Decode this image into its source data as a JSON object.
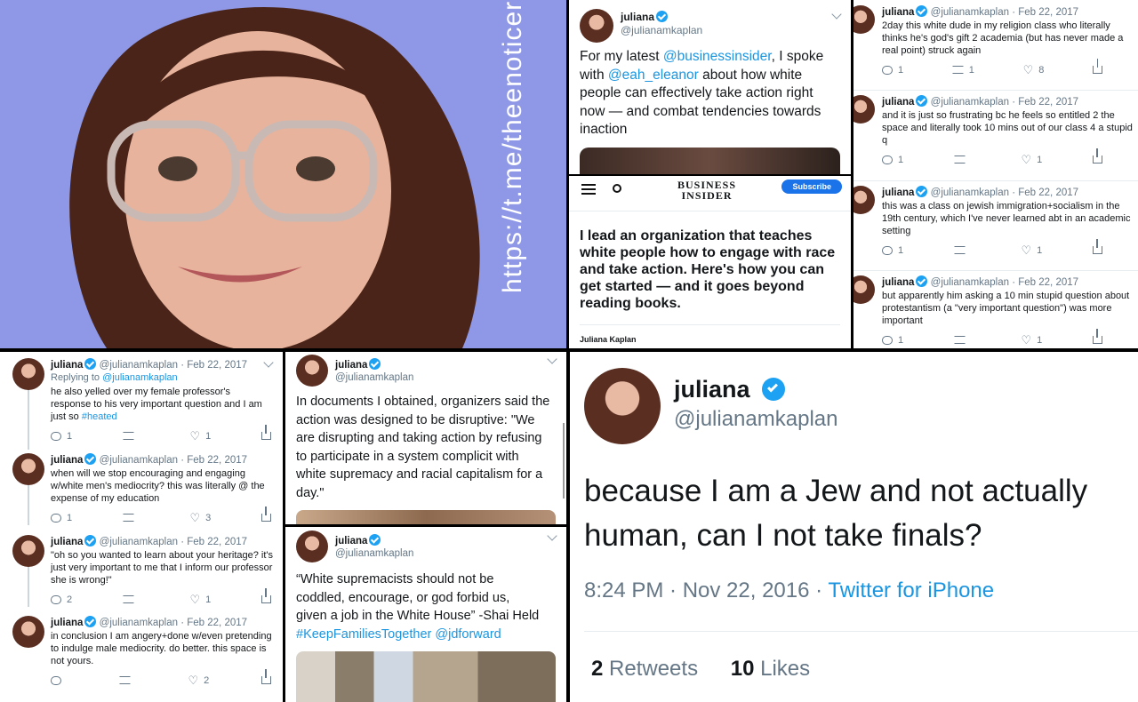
{
  "photo": {
    "watermark": "https://t.me/theenoticer",
    "background": "#8f98e6"
  },
  "user": {
    "name": "juliana",
    "handle": "@julianamkaplan"
  },
  "tweet_bi": {
    "segments": [
      "For my latest ",
      "@businessinsider",
      ", I spoke with ",
      "@eah_eleanor",
      " about how white people can effectively take action right now — and combat tendencies towards inaction"
    ]
  },
  "article": {
    "logo_line1": "BUSINESS",
    "logo_line2": "INSIDER",
    "subscribe": "Subscribe",
    "headline": "I lead an organization that teaches white people how to engage with race and take action. Here's how you can get started — and it goes beyond reading books.",
    "author": "Juliana Kaplan"
  },
  "thread_right": [
    {
      "date": "· Feb 22, 2017",
      "text": "2day this white dude in my religion class who literally thinks he's god's gift 2 academia (but has never made a real point) struck again",
      "replies": "1",
      "retweets": "1",
      "likes": "8"
    },
    {
      "date": "· Feb 22, 2017",
      "text": "and it is just so frustrating bc he feels so entitled 2 the space and literally took 10 mins out of our class 4 a stupid q",
      "replies": "1",
      "retweets": "",
      "likes": "1"
    },
    {
      "date": "· Feb 22, 2017",
      "text": "this was a class on jewish immigration+socialism in the 19th century, which I've never learned abt in an academic setting",
      "replies": "1",
      "retweets": "",
      "likes": "1"
    },
    {
      "date": "· Feb 22, 2017",
      "text": "but apparently him asking a 10 min stupid question about protestantism (a \"very important question\") was more important",
      "replies": "1",
      "retweets": "",
      "likes": "1"
    }
  ],
  "thread_left": [
    {
      "date": "· Feb 22, 2017",
      "replying_to": "Replying to",
      "replying_handle": "@julianamkaplan",
      "text": "he also yelled over my female professor's response to his very important question and I am just so ",
      "hashtag": "#heated",
      "replies": "1",
      "retweets": "",
      "likes": "1"
    },
    {
      "date": "· Feb 22, 2017",
      "text": "when will we stop encouraging and engaging w/white men's mediocrity? this was literally @ the expense of my education",
      "replies": "1",
      "retweets": "",
      "likes": "3"
    },
    {
      "date": "· Feb 22, 2017",
      "text": "\"oh so you wanted to learn about your heritage? it's just very important to me that I inform our professor she is wrong!\"",
      "replies": "2",
      "retweets": "",
      "likes": "1"
    },
    {
      "date": "· Feb 22, 2017",
      "text": "in conclusion I am angery+done w/even pretending to indulge male mediocrity. do better. this space is not yours.",
      "replies": "",
      "retweets": "",
      "likes": "2"
    }
  ],
  "tweet_docs": {
    "text": "In documents I obtained, organizers said the action was designed to be disruptive: \"We are disrupting and taking action by refusing to participate in a system complicit with white supremacy and racial capitalism for a day.\""
  },
  "tweet_shai": {
    "text": "“White supremacists should not be coddled, encourage, or god forbid us, given a job in the White House” -Shai Held ",
    "hashtag": "#KeepFamiliesTogether",
    "mention": " @jdforward"
  },
  "tweet_big": {
    "text": "because I am a Jew and not actually human, can I not take finals?",
    "time": "8:24 PM · Nov 22, 2016 · ",
    "source": "Twitter for iPhone",
    "retweets_count": "2",
    "retweets_label": " Retweets",
    "likes_count": "10",
    "likes_label": " Likes"
  },
  "colors": {
    "link": "#1b95e0",
    "verified": "#1da1f2",
    "text": "#14171a",
    "muted": "#657786"
  }
}
